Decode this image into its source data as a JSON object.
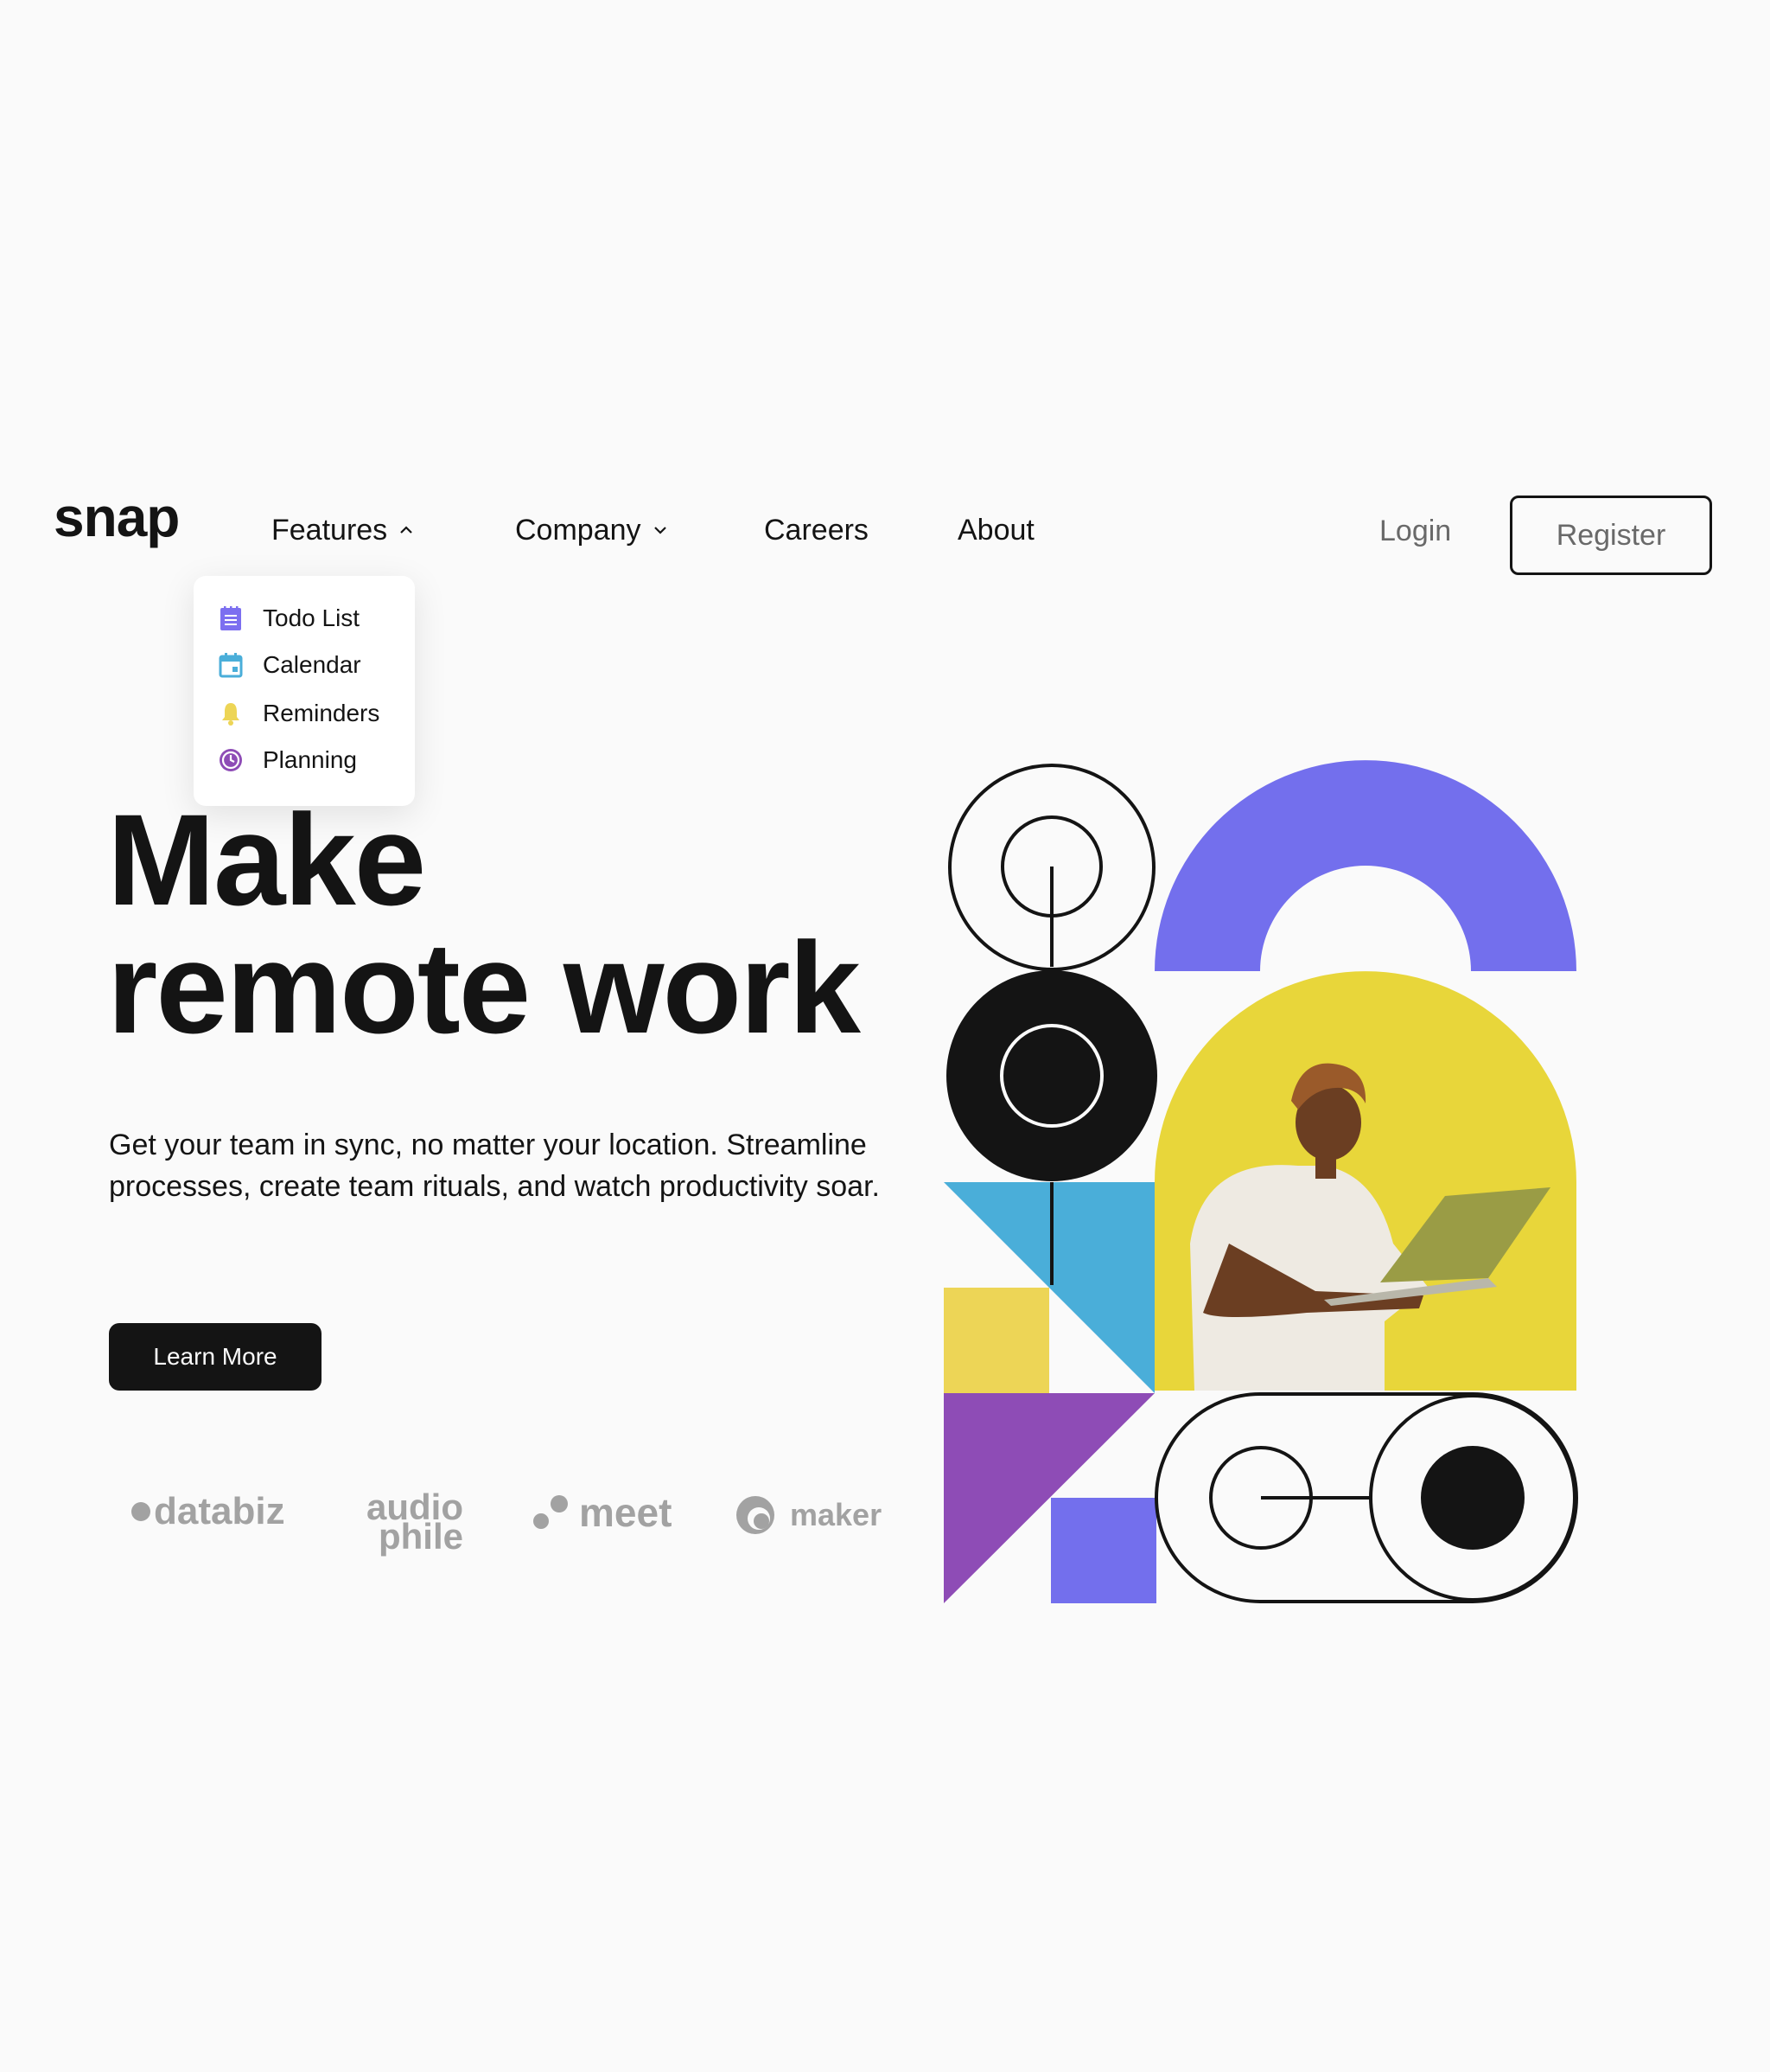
{
  "header": {
    "logo": "snap",
    "nav": [
      {
        "label": "Features",
        "icon": "chevron-up-icon"
      },
      {
        "label": "Company",
        "icon": "chevron-down-icon"
      },
      {
        "label": "Careers"
      },
      {
        "label": "About"
      }
    ],
    "login_label": "Login",
    "register_label": "Register"
  },
  "features_dropdown": {
    "items": [
      {
        "label": "Todo List",
        "icon": "todo-list-icon",
        "color": "#7c6ff0"
      },
      {
        "label": "Calendar",
        "icon": "calendar-icon",
        "color": "#4aaed9"
      },
      {
        "label": "Reminders",
        "icon": "bell-icon",
        "color": "#edd556"
      },
      {
        "label": "Planning",
        "icon": "planning-clock-icon",
        "color": "#8e4cb6"
      }
    ]
  },
  "hero": {
    "headline_line1": "Make",
    "headline_line2": "remote work",
    "subtext": "Get your team in sync, no matter your location. Streamline processes, create team rituals, and watch productivity soar.",
    "cta_label": "Learn More"
  },
  "clients": [
    {
      "name": "databiz"
    },
    {
      "name_top": "audio",
      "name_bottom": "phile"
    },
    {
      "name": "meet"
    },
    {
      "name": "maker"
    }
  ],
  "colors": {
    "background": "#fafafa",
    "text": "#141414",
    "muted": "#696969",
    "purple_shape": "#736fed",
    "yellow_shape": "#edd556",
    "blue_shape": "#4aaed9",
    "violet_shape": "#8e4cb6",
    "arch_yellow": "#e8d63a"
  }
}
